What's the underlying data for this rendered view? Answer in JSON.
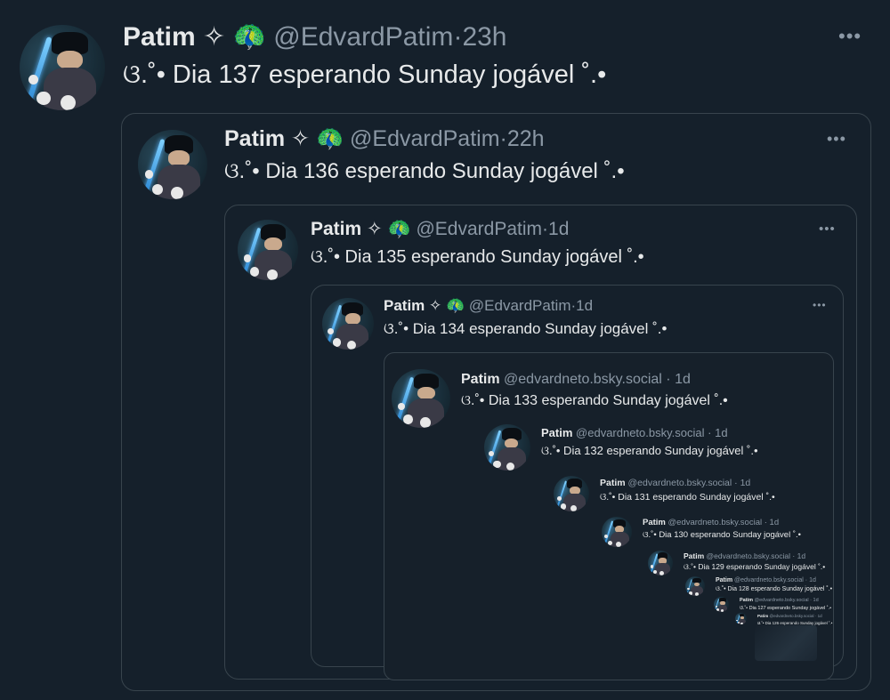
{
  "posts": [
    {
      "name": "Patim",
      "badge": "✧",
      "emoji": "🦚",
      "handle": "@EdvardPatim",
      "sep": "·",
      "time": "23h",
      "text": "ଓ.˚• Dia 137 esperando Sunday jogável ˚.•"
    },
    {
      "name": "Patim",
      "badge": "✧",
      "emoji": "🦚",
      "handle": "@EdvardPatim",
      "sep": "·",
      "time": "22h",
      "text": "ଓ.˚• Dia 136 esperando Sunday jogável ˚.•"
    },
    {
      "name": "Patim",
      "badge": "✧",
      "emoji": "🦚",
      "handle": "@EdvardPatim",
      "sep": "·",
      "time": "1d",
      "text": "ଓ.˚• Dia 135 esperando Sunday jogável ˚.•"
    },
    {
      "name": "Patim",
      "badge": "✧",
      "emoji": "🦚",
      "handle": "@EdvardPatim",
      "sep": "·",
      "time": "1d",
      "text": "ଓ.˚• Dia 134 esperando Sunday jogável ˚.•"
    }
  ],
  "bsky_posts": [
    {
      "name": "Patim",
      "handle": "@edvardneto.bsky.social",
      "sep": "·",
      "time": "1d",
      "text": "ଓ.˚• Dia 133 esperando Sunday jogável ˚.•"
    },
    {
      "name": "Patim",
      "handle": "@edvardneto.bsky.social",
      "sep": "·",
      "time": "1d",
      "text": "ଓ.˚• Dia 132 esperando Sunday jogável ˚.•"
    },
    {
      "name": "Patim",
      "handle": "@edvardneto.bsky.social",
      "sep": "·",
      "time": "1d",
      "text": "ଓ.˚• Dia 131 esperando Sunday jogável ˚.•"
    },
    {
      "name": "Patim",
      "handle": "@edvardneto.bsky.social",
      "sep": "·",
      "time": "1d",
      "text": "ଓ.˚• Dia 130 esperando Sunday jogável ˚.•"
    },
    {
      "name": "Patim",
      "handle": "@edvardneto.bsky.social",
      "sep": "·",
      "time": "1d",
      "text": "ଓ.˚• Dia 129 esperando Sunday jogável ˚.•"
    },
    {
      "name": "Patim",
      "handle": "@edvardneto.bsky.social",
      "sep": "·",
      "time": "1d",
      "text": "ଓ.˚• Dia 128 esperando Sunday jogável ˚.•"
    },
    {
      "name": "Patim",
      "handle": "@edvardneto.bsky.social",
      "sep": "·",
      "time": "1d",
      "text": "ଓ.˚• Dia 127 esperando Sunday jogável ˚.•"
    },
    {
      "name": "Patim",
      "handle": "@edvardneto.bsky.social",
      "sep": "·",
      "time": "1d",
      "text": "ଓ.˚• Dia 126 esperando Sunday jogável ˚.•"
    }
  ],
  "more_glyph": "•••",
  "icons": {
    "more": "more-options-icon",
    "badge": "sparkle-badge-icon",
    "emoji": "peacock-emoji-icon"
  },
  "colors": {
    "background": "#15202b",
    "text": "#e7e9ea",
    "secondary": "#8b98a5",
    "border": "#38444d"
  }
}
